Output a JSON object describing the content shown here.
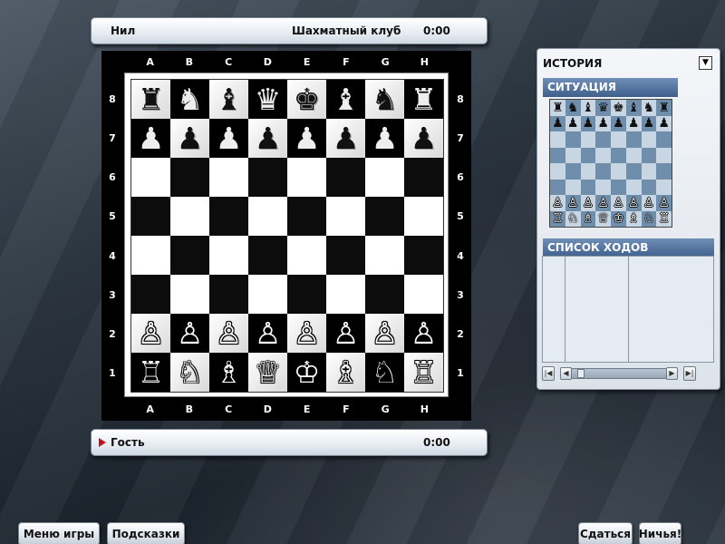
{
  "top_player": {
    "name": "Нил",
    "club": "Шахматный клуб",
    "time": "0:00"
  },
  "bottom_player": {
    "name": "Гость",
    "time": "0:00",
    "turn_indicator": "flag-icon"
  },
  "board": {
    "files": [
      "A",
      "B",
      "C",
      "D",
      "E",
      "F",
      "G",
      "H"
    ],
    "ranks": [
      "8",
      "7",
      "6",
      "5",
      "4",
      "3",
      "2",
      "1"
    ],
    "position": [
      [
        "♜",
        "♞",
        "♝",
        "♛",
        "♚",
        "♝",
        "♞",
        "♜"
      ],
      [
        "♟",
        "♟",
        "♟",
        "♟",
        "♟",
        "♟",
        "♟",
        "♟"
      ],
      [
        "",
        "",
        "",
        "",
        "",
        "",
        "",
        ""
      ],
      [
        "",
        "",
        "",
        "",
        "",
        "",
        "",
        ""
      ],
      [
        "",
        "",
        "",
        "",
        "",
        "",
        "",
        ""
      ],
      [
        "",
        "",
        "",
        "",
        "",
        "",
        "",
        ""
      ],
      [
        "♙",
        "♙",
        "♙",
        "♙",
        "♙",
        "♙",
        "♙",
        "♙"
      ],
      [
        "♖",
        "♘",
        "♗",
        "♕",
        "♔",
        "♗",
        "♘",
        "♖"
      ]
    ]
  },
  "history_panel": {
    "title": "ИСТОРИЯ",
    "dropdown_icon": "chevron-down-icon",
    "situation_label": "СИТУАЦИЯ",
    "moves_label": "СПИСОК ХОДОВ",
    "moves": []
  },
  "buttons": {
    "game_menu": "Меню игры",
    "hints": "Подсказки",
    "resign": "Сдаться",
    "draw": "Ничья!"
  },
  "colors": {
    "section_header": "#4a6a96",
    "turn_flag": "#c0141b",
    "mini_light": "#c8d6e3",
    "mini_dark": "#6f8eab"
  }
}
